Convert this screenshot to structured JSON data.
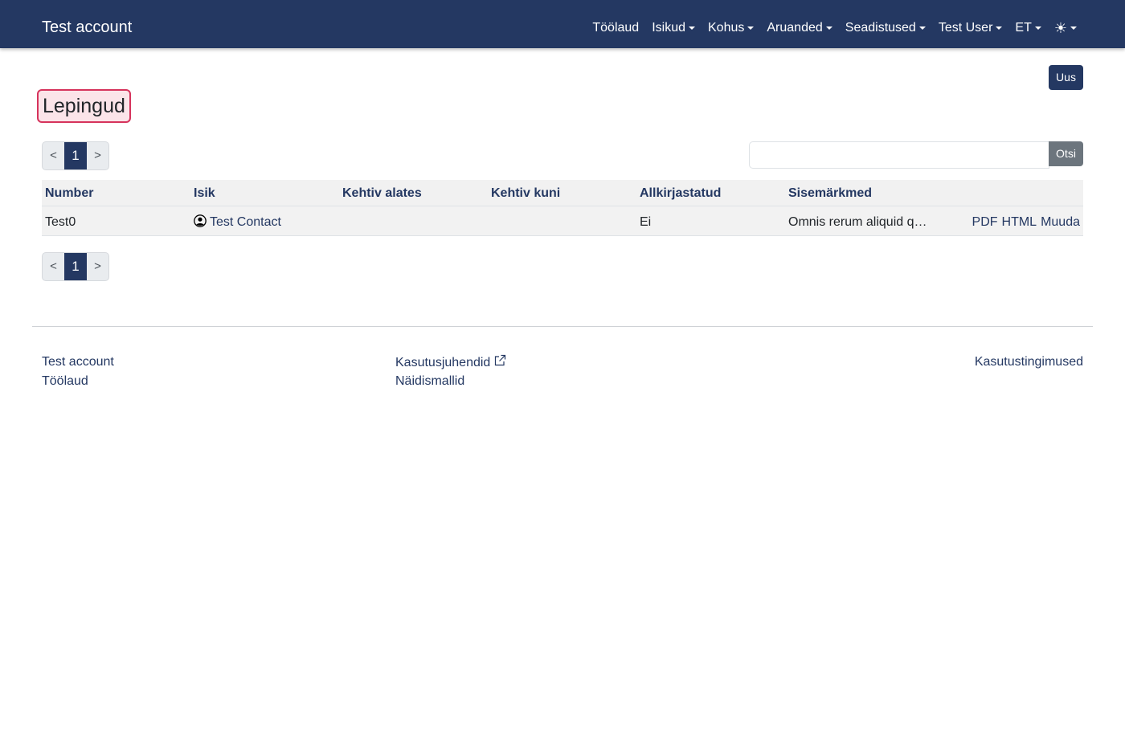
{
  "navbar": {
    "brand": "Test account",
    "items": [
      {
        "label": "Töölaud",
        "dropdown": false
      },
      {
        "label": "Isikud",
        "dropdown": true
      },
      {
        "label": "Kohus",
        "dropdown": true
      },
      {
        "label": "Aruanded",
        "dropdown": true
      },
      {
        "label": "Seadistused",
        "dropdown": true
      },
      {
        "label": "Test User",
        "dropdown": true
      },
      {
        "label": "ET",
        "dropdown": true
      }
    ],
    "theme_icon": "☀"
  },
  "toolbar": {
    "new_label": "Uus"
  },
  "page": {
    "title": "Lepingud"
  },
  "pagination": {
    "prev": "<",
    "current": "1",
    "next": ">"
  },
  "search": {
    "value": "",
    "placeholder": "",
    "button_label": "Otsi"
  },
  "table": {
    "headers": [
      "Number",
      "Isik",
      "Kehtiv alates",
      "Kehtiv kuni",
      "Allkirjastatud",
      "Sisemärkmed"
    ],
    "rows": [
      {
        "number": "Test0",
        "person": "Test Contact",
        "valid_from": "",
        "valid_to": "",
        "signed": "Ei",
        "notes": "Omnis rerum aliquid q…",
        "actions": [
          "PDF",
          "HTML",
          "Muuda"
        ]
      }
    ]
  },
  "footer": {
    "brand": "Test account",
    "dashboard": "Töölaud",
    "manuals": "Kasutusjuhendid",
    "templates": "Näidismallid",
    "terms": "Kasutustingimused"
  },
  "colors": {
    "primary": "#243862",
    "highlight_border": "#d6335c",
    "highlight_bg": "#fbe4e9",
    "secondary": "#6c757d"
  }
}
